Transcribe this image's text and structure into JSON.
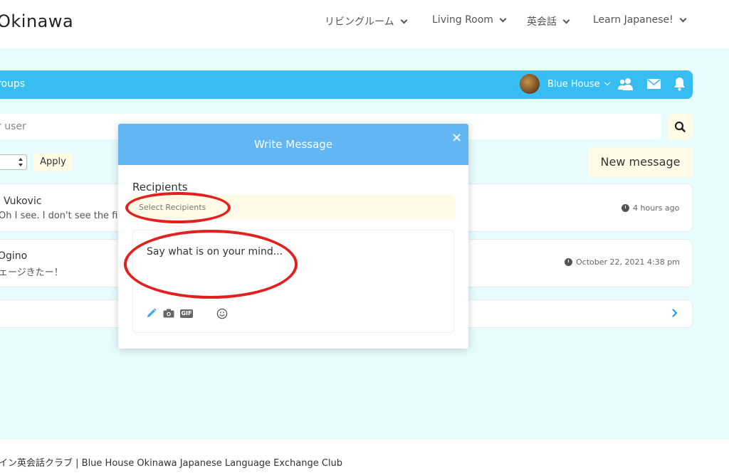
{
  "site": {
    "brand": "Okinawa",
    "nav": [
      {
        "label": "リビングルーム"
      },
      {
        "label": "Living Room"
      },
      {
        "label": "英会話"
      },
      {
        "label": "Learn Japanese!"
      }
    ]
  },
  "header": {
    "title": "roups",
    "user_name": "Blue House",
    "icons": [
      "friends-icon",
      "mail-icon",
      "bell-icon"
    ]
  },
  "search": {
    "placeholder": "r user",
    "button_icon": "search-icon"
  },
  "filters": {
    "apply_label": "Apply",
    "new_message_label": "New message"
  },
  "messages": [
    {
      "name": "Vukovic",
      "preview": "Oh I see. I don't see the file",
      "time": "4 hours ago"
    },
    {
      "name": "Ogino",
      "preview": "ェージきたー！",
      "time": "October 22, 2021 4:38 pm"
    }
  ],
  "modal": {
    "title": "Write Message",
    "close_label": "×",
    "recipients_label": "Recipients",
    "recipients_placeholder": "Select Recipients",
    "compose_placeholder": "Say what is on your mind...",
    "tools": [
      "pencil-icon",
      "camera-icon",
      "gif-icon",
      "emoji-icon"
    ],
    "gif_label": "GIF"
  },
  "footer": {
    "text": "イン英会話クラブ | Blue House Okinawa Japanese Language Exchange Club"
  },
  "colors": {
    "header_bar": "#37bdf2",
    "modal_header": "#62b7f3",
    "page_bg": "#e8fbfd",
    "button_bg": "#fffbe6",
    "annotation_ring": "#e3201f"
  }
}
